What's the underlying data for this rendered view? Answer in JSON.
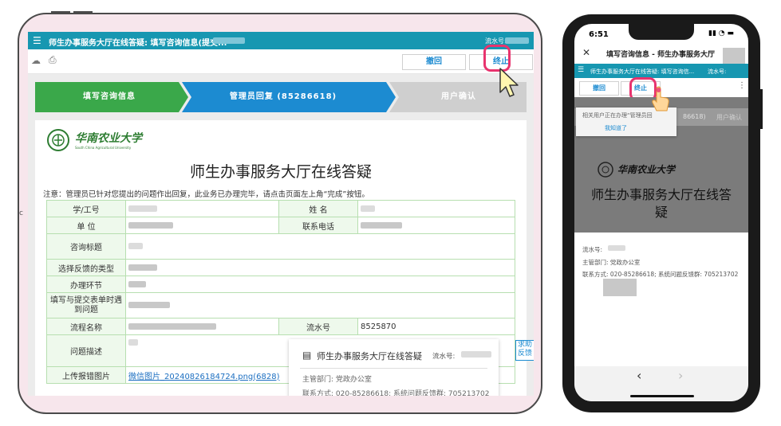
{
  "tablet": {
    "window_title": "师生办事服务大厅在线答疑: 填写咨询信息(提交...",
    "serial_label": "流水号:",
    "toolbar": {
      "back_label": "撤回",
      "stop_label": "终止"
    },
    "steps": [
      {
        "label": "填写咨询信息",
        "color": "#3aa84a"
      },
      {
        "label": "管理员回复 (85286618)",
        "color": "#1c8bd1"
      },
      {
        "label": "用户确认",
        "color": "#cfcfcf"
      }
    ],
    "logo_cn": "华南农业大学",
    "logo_en": "South China Agricultural University",
    "page_title": "师生办事服务大厅在线答疑",
    "notice": "注意：管理员已针对您提出的问题作出回复，此业务已办理完毕，请点击页面左上角“完成”按钮。",
    "form": {
      "student_id": "学/工号",
      "name": "姓    名",
      "unit": "单    位",
      "phone": "联系电话",
      "topic": "咨询标题",
      "feedback_type": "选择反馈的类型",
      "step": "办理环节",
      "problem_time": "填写与提交表单时遇到问题",
      "process_name": "流程名称",
      "serial_no": "流水号",
      "serial_no_value": "8525870",
      "description": "问题描述",
      "upload": "上传报错图片",
      "upload_file": "微信图片_20240826184724.png(6828)"
    },
    "help_label": "求助反馈",
    "popup": {
      "title": "师生办事服务大厅在线答疑",
      "serial_label": "流水号:",
      "dept": "主管部门: 党政办公室",
      "contact": "联系方式: 020-85286618; 系统问题反馈群: 705213702"
    }
  },
  "phone": {
    "time": "6:51",
    "title": "填写咨询信息 - 师生办事服务大厅",
    "subtitle": "师生办事服务大厅在线答疑: 填写咨询信...",
    "subtitle_serial": "流水号:",
    "toolbar": {
      "back_label": "撤回",
      "stop_label": "终止"
    },
    "toast_text": "相关用户正在办理“管理员回",
    "toast_button": "我知道了",
    "step_text": "86618)",
    "step3_text": "用户确认",
    "logo_cn": "华南农业大学",
    "page_title": "师生办事服务大厅在线答疑",
    "serial_label": "流水号:",
    "dept": "主管部门: 党政办公室",
    "contact": "联系方式: 020-85286618; 系统问题反馈群: 705213702",
    "nav_back": "‹",
    "nav_fwd": "›"
  },
  "colors": {
    "teal": "#1797b1",
    "green": "#3aa84a",
    "blue": "#1c8bd1",
    "highlight": "#e8336e"
  }
}
